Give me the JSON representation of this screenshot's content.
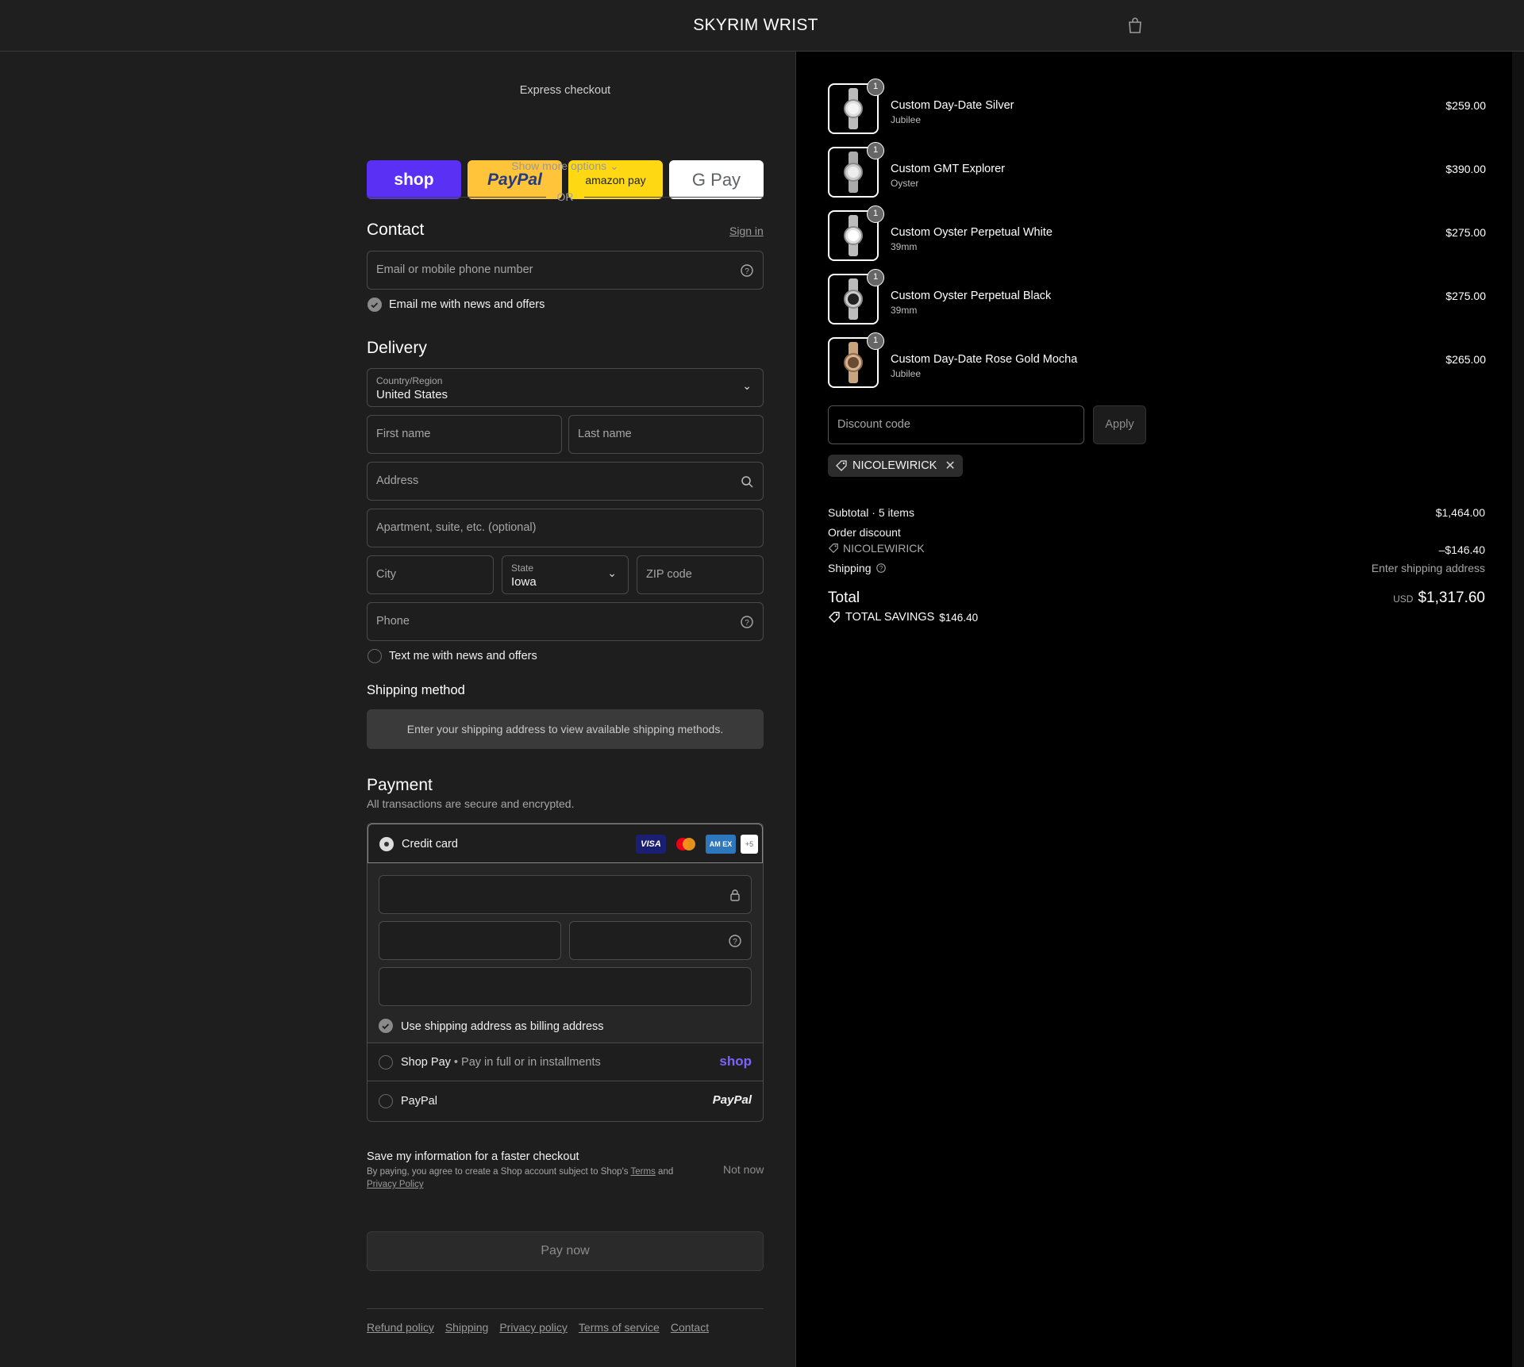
{
  "header": {
    "brand": "SKYRIM WRIST",
    "cart_icon": "shopping-bag-icon"
  },
  "express": {
    "title": "Express checkout",
    "buttons": [
      {
        "label": "shop",
        "color": "#5a31f4"
      },
      {
        "label": "PayPal",
        "color": "#ffc439"
      },
      {
        "label": "amazon pay",
        "color": "#ffd814"
      },
      {
        "label": "G Pay",
        "color": "#ffffff"
      }
    ],
    "more": "Show more options",
    "or": "OR"
  },
  "contact": {
    "title": "Contact",
    "sign_in": "Sign in",
    "email_placeholder": "Email or mobile phone number",
    "email_news": "Email me with news and offers"
  },
  "delivery": {
    "title": "Delivery",
    "country_label": "Country/Region",
    "country_value": "United States",
    "first_name": "First name",
    "last_name": "Last name",
    "address": "Address",
    "apartment": "Apartment, suite, etc. (optional)",
    "city": "City",
    "state_label": "State",
    "state_value": "Iowa",
    "zip": "ZIP code",
    "phone": "Phone",
    "text_news": "Text me with news and offers"
  },
  "shipping_method": {
    "title": "Shipping method",
    "message": "Enter your shipping address to view available shipping methods."
  },
  "payment": {
    "title": "Payment",
    "subtitle": "All transactions are secure and encrypted.",
    "credit_card": "Credit card",
    "card_more": "+5",
    "billing_same": "Use shipping address as billing address",
    "shop_pay": "Shop Pay",
    "shop_pay_sub": "Pay in full or in installments",
    "shop_pay_logo": "shop",
    "paypal": "PayPal",
    "paypal_logo": "PayPal",
    "visa": "VISA",
    "amex": "AM EX"
  },
  "save_info": {
    "title": "Save my information for a faster checkout",
    "text": "By paying, you agree to create a Shop account subject to Shop's",
    "terms": "Terms",
    "and": "and",
    "privacy": "Privacy Policy",
    "not_now": "Not now"
  },
  "pay_now": "Pay now",
  "footer": [
    "Refund policy",
    "Shipping",
    "Privacy policy",
    "Terms of service",
    "Contact"
  ],
  "items": [
    {
      "name": "Custom Day-Date Silver",
      "variant": "Jubilee",
      "price": "$259.00",
      "qty": "1"
    },
    {
      "name": "Custom GMT Explorer",
      "variant": "Oyster",
      "price": "$390.00",
      "qty": "1"
    },
    {
      "name": "Custom Oyster Perpetual White",
      "variant": "39mm",
      "price": "$275.00",
      "qty": "1"
    },
    {
      "name": "Custom Oyster Perpetual Black",
      "variant": "39mm",
      "price": "$275.00",
      "qty": "1"
    },
    {
      "name": "Custom Day-Date Rose Gold Mocha",
      "variant": "Jubilee",
      "price": "$265.00",
      "qty": "1"
    }
  ],
  "discount": {
    "placeholder": "Discount code",
    "apply": "Apply",
    "code": "NICOLEWIRICK"
  },
  "summary": {
    "subtotal_label": "Subtotal · 5 items",
    "subtotal": "$1,464.00",
    "order_discount": "Order discount",
    "discount_code": "NICOLEWIRICK",
    "discount_amount": "–$146.40",
    "shipping_label": "Shipping",
    "shipping_value": "Enter shipping address",
    "total_label": "Total",
    "currency": "USD",
    "total": "$1,317.60",
    "savings_label": "TOTAL SAVINGS",
    "savings": "$146.40"
  }
}
